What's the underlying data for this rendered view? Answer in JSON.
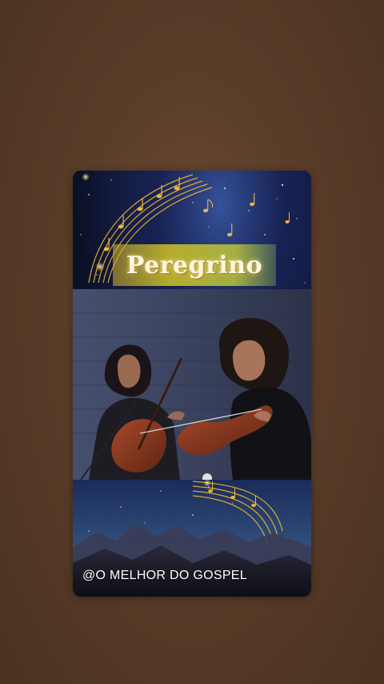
{
  "story": {
    "title": "Peregrino",
    "handle": "@O MELHOR DO GOSPEL"
  },
  "colors": {
    "background": "#5a3d29",
    "night_sky": "#0b1026",
    "banner_gold": "#c4b828",
    "note_gold": "#f2b632"
  },
  "icons": {
    "music_notes": "music-notes-icon"
  }
}
